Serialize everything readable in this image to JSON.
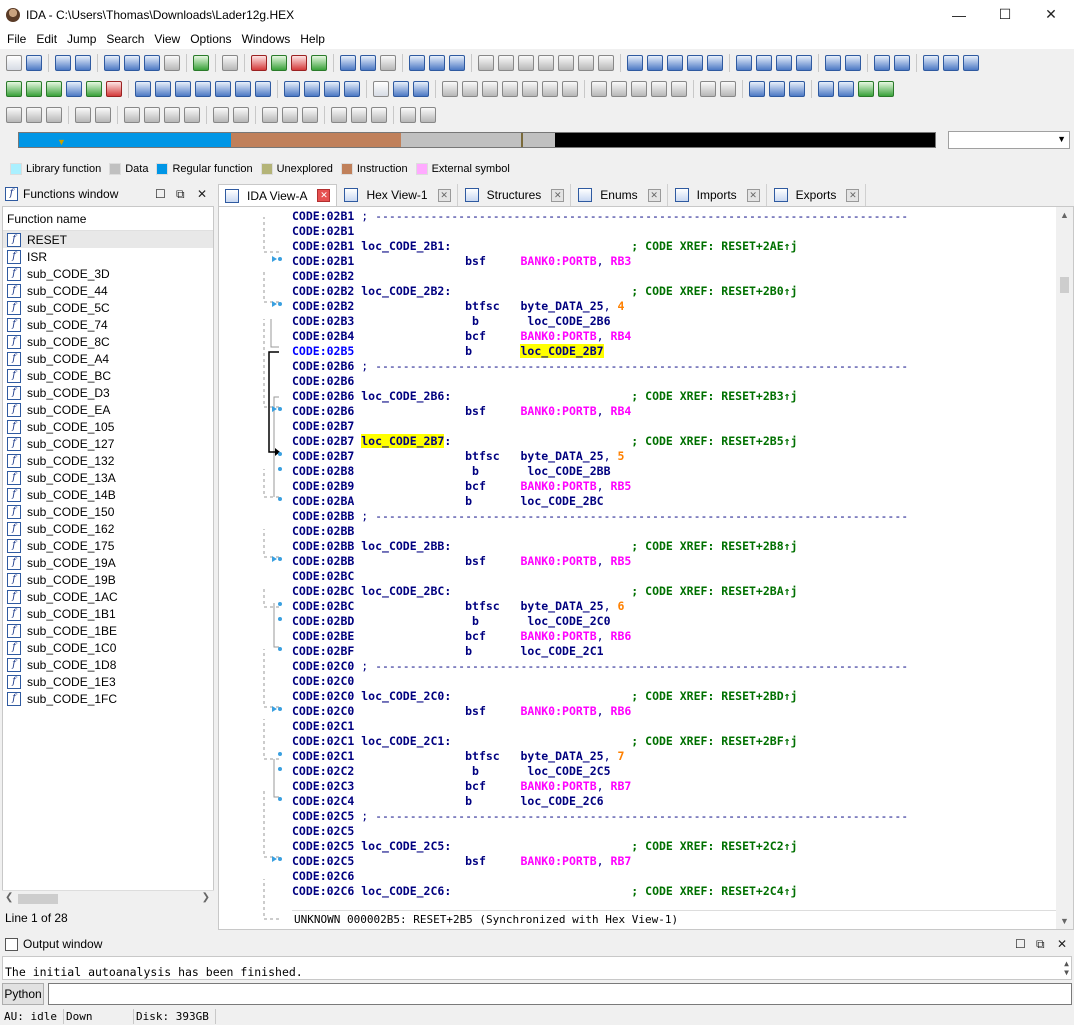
{
  "window": {
    "title": "IDA - C:\\Users\\Thomas\\Downloads\\Lader12g.HEX",
    "controls": [
      "—",
      "☐",
      "✕"
    ]
  },
  "menu": [
    "File",
    "Edit",
    "Jump",
    "Search",
    "View",
    "Options",
    "Windows",
    "Help"
  ],
  "legend": [
    {
      "label": "Library function",
      "color": "#aaf0ff"
    },
    {
      "label": "Data",
      "color": "#c0c0c0"
    },
    {
      "label": "Regular function",
      "color": "#0096e6"
    },
    {
      "label": "Unexplored",
      "color": "#b4b478"
    },
    {
      "label": "Instruction",
      "color": "#c0805a"
    },
    {
      "label": "External symbol",
      "color": "#ffaaff"
    }
  ],
  "functions_window": {
    "title": "Functions window",
    "column": "Function name",
    "items": [
      "RESET",
      "ISR",
      "sub_CODE_3D",
      "sub_CODE_44",
      "sub_CODE_5C",
      "sub_CODE_74",
      "sub_CODE_8C",
      "sub_CODE_A4",
      "sub_CODE_BC",
      "sub_CODE_D3",
      "sub_CODE_EA",
      "sub_CODE_105",
      "sub_CODE_127",
      "sub_CODE_132",
      "sub_CODE_13A",
      "sub_CODE_14B",
      "sub_CODE_150",
      "sub_CODE_162",
      "sub_CODE_175",
      "sub_CODE_19A",
      "sub_CODE_19B",
      "sub_CODE_1AC",
      "sub_CODE_1B1",
      "sub_CODE_1BE",
      "sub_CODE_1C0",
      "sub_CODE_1D8",
      "sub_CODE_1E3",
      "sub_CODE_1FC"
    ],
    "status": "Line 1 of 28"
  },
  "tabs": [
    {
      "label": "IDA View-A",
      "active": true
    },
    {
      "label": "Hex View-1",
      "active": false
    },
    {
      "label": "Structures",
      "active": false
    },
    {
      "label": "Enums",
      "active": false
    },
    {
      "label": "Imports",
      "active": false
    },
    {
      "label": "Exports",
      "active": false
    }
  ],
  "ida_status": "UNKNOWN 000002B5: RESET+2B5 (Synchronized with Hex View-1)",
  "output": {
    "title": "Output window",
    "text": "The initial autoanalysis has been finished.",
    "python_label": "Python"
  },
  "statusbar": [
    "AU:  idle",
    "Down",
    "Disk: 393GB"
  ],
  "icons": {
    "function": "function-f-icon",
    "close": "close-icon",
    "float": "float-window-icon",
    "restore": "restore-window-icon"
  }
}
